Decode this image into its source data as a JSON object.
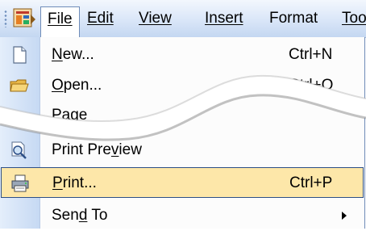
{
  "menubar": {
    "items": [
      {
        "label": "File",
        "mnemonic_index": 0
      },
      {
        "label": "Edit",
        "mnemonic_index": 0
      },
      {
        "label": "View",
        "mnemonic_index": 0
      },
      {
        "label": "Insert",
        "mnemonic_index": 0
      },
      {
        "label": "Format",
        "mnemonic_index": 1
      },
      {
        "label": "Too",
        "mnemonic_index": 0
      }
    ],
    "open_item": "File"
  },
  "file_menu": {
    "new": {
      "pre": "",
      "mn": "N",
      "post": "ew...",
      "shortcut": "Ctrl+N"
    },
    "open": {
      "pre": "",
      "mn": "O",
      "post": "pen...",
      "shortcut": "Ctrl+O"
    },
    "page": {
      "label": "Page"
    },
    "print_preview": {
      "pre": "Print Pre",
      "mn": "v",
      "post": "iew"
    },
    "print": {
      "pre": "",
      "mn": "P",
      "post": "rint...",
      "shortcut": "Ctrl+P"
    },
    "send_to": {
      "pre": "Sen",
      "mn": "d",
      "post": " To"
    }
  },
  "colors": {
    "highlight_bg": "#fde7a9",
    "highlight_border": "#2d4f87",
    "menubar_gradient_end": "#c4d7f1"
  },
  "icons": {
    "app": "office-app-icon",
    "new": "new-document-icon",
    "open": "open-folder-icon",
    "print_preview": "print-preview-icon",
    "print": "printer-icon"
  }
}
